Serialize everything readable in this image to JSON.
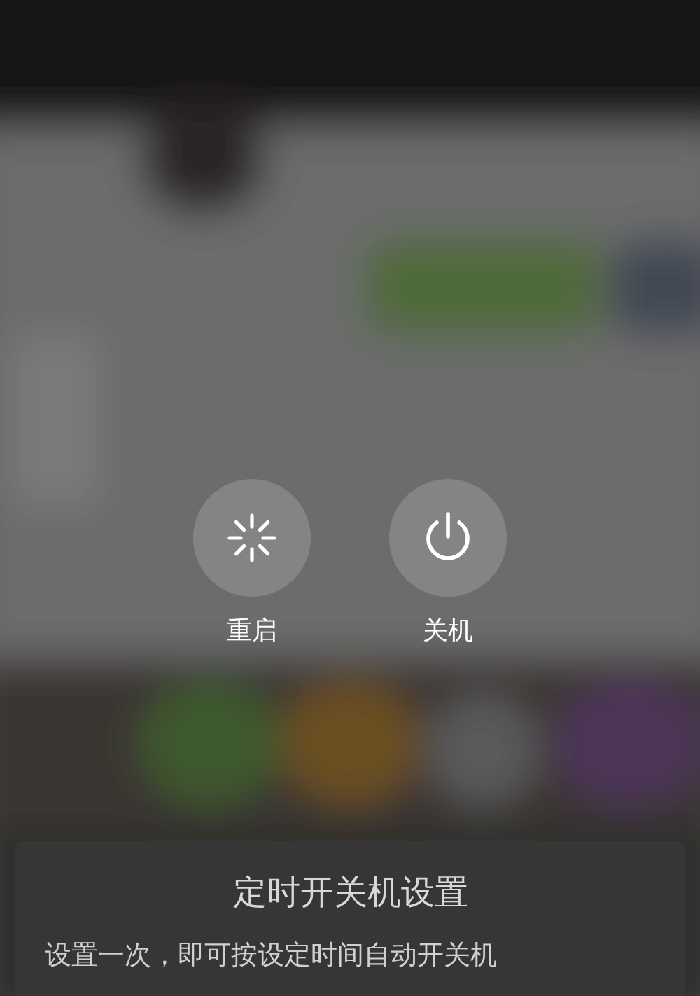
{
  "actions": [
    {
      "kind": "restart",
      "label": "重启"
    },
    {
      "kind": "power",
      "label": "关机"
    }
  ],
  "panel": {
    "title": "定时开关机设置",
    "description": "设置一次，即可按设定时间自动开关机"
  }
}
